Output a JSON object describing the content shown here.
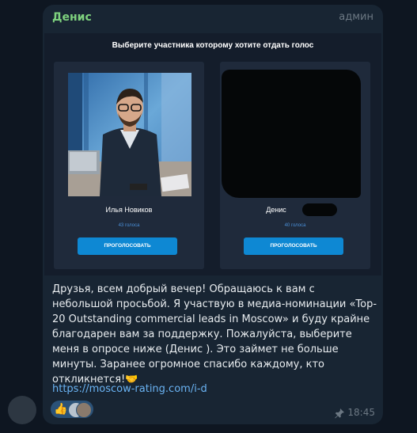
{
  "message": {
    "sender": "Денис",
    "role": "админ",
    "time": "18:45",
    "link": "https://moscow-rating.com/i-d",
    "body": "Друзья, всем добрый вечер! Обращаюсь к вам с небольшой просьбой. Я участвую в медиа-номинации «Top-20 Outstanding commercial leads in Moscow» и буду крайне благодарен вам за поддержку. Пожалуйста, выберите меня в опросе ниже (Денис              ). Это займет не больше минуты. Заранее огромное спасибо каждому, кто откликнется!🤝"
  },
  "poll": {
    "title": "Выберите участника которому хотите отдать голос",
    "candidates": [
      {
        "name": "Илья Новиков",
        "votes": "43 голоса",
        "button": "ПРОГОЛОСОВАТЬ"
      },
      {
        "name": "Денис",
        "votes": "40 голоса",
        "button": "ПРОГОЛОСОВАТЬ"
      }
    ]
  },
  "reactions": {
    "emoji": "👍"
  },
  "icons": {
    "pin": "pin-icon",
    "handshake": "handshake-emoji"
  },
  "colors": {
    "sender": "#7ed27e",
    "link": "#6ab3f3",
    "button": "#0e88d3"
  }
}
